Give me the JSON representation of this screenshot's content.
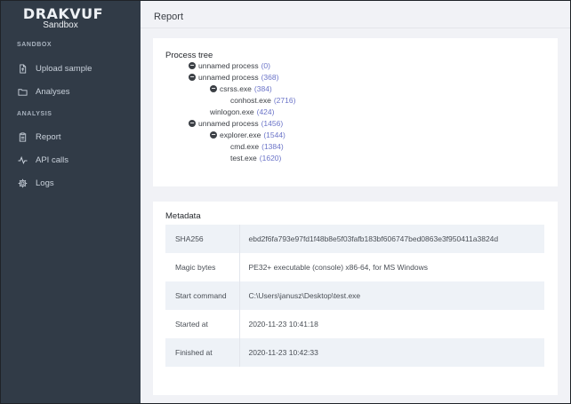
{
  "brand": {
    "title": "DRAKVUF",
    "subtitle": "Sandbox"
  },
  "sidebar": {
    "sections": [
      {
        "label": "SANDBOX",
        "items": [
          {
            "label": "Upload sample",
            "icon": "file-upload-icon"
          },
          {
            "label": "Analyses",
            "icon": "folder-icon"
          }
        ]
      },
      {
        "label": "ANALYSIS",
        "items": [
          {
            "label": "Report",
            "icon": "clipboard-icon"
          },
          {
            "label": "API calls",
            "icon": "activity-icon"
          },
          {
            "label": "Logs",
            "icon": "gear-icon"
          }
        ]
      }
    ]
  },
  "header": {
    "title": "Report"
  },
  "process_tree": {
    "title": "Process tree",
    "nodes": [
      {
        "name": "unnamed process",
        "pid": "(0)",
        "depth": 0,
        "toggle": "−"
      },
      {
        "name": "unnamed process",
        "pid": "(368)",
        "depth": 0,
        "toggle": "−"
      },
      {
        "name": "csrss.exe",
        "pid": "(384)",
        "depth": 1,
        "toggle": "−"
      },
      {
        "name": "conhost.exe",
        "pid": "(2716)",
        "depth": 2,
        "toggle": ""
      },
      {
        "name": "winlogon.exe",
        "pid": "(424)",
        "depth": 1,
        "toggle": ""
      },
      {
        "name": "unnamed process",
        "pid": "(1456)",
        "depth": 0,
        "toggle": "−"
      },
      {
        "name": "explorer.exe",
        "pid": "(1544)",
        "depth": 1,
        "toggle": "−"
      },
      {
        "name": "cmd.exe",
        "pid": "(1384)",
        "depth": 2,
        "toggle": ""
      },
      {
        "name": "test.exe",
        "pid": "(1620)",
        "depth": 2,
        "toggle": ""
      }
    ]
  },
  "metadata": {
    "title": "Metadata",
    "rows": [
      {
        "key": "SHA256",
        "value": "ebd2f6fa793e97fd1f48b8e5f03fafb183bf606747bed0863e3f950411a3824d"
      },
      {
        "key": "Magic bytes",
        "value": "PE32+ executable (console) x86-64, for MS Windows"
      },
      {
        "key": "Start command",
        "value": "C:\\Users\\janusz\\Desktop\\test.exe"
      },
      {
        "key": "Started at",
        "value": "2020-11-23 10:41:18"
      },
      {
        "key": "Finished at",
        "value": "2020-11-23 10:42:33"
      }
    ]
  },
  "colors": {
    "sidebar_bg": "#313b47",
    "pid_link": "#6b74c8",
    "main_bg": "#f1f2f6"
  }
}
